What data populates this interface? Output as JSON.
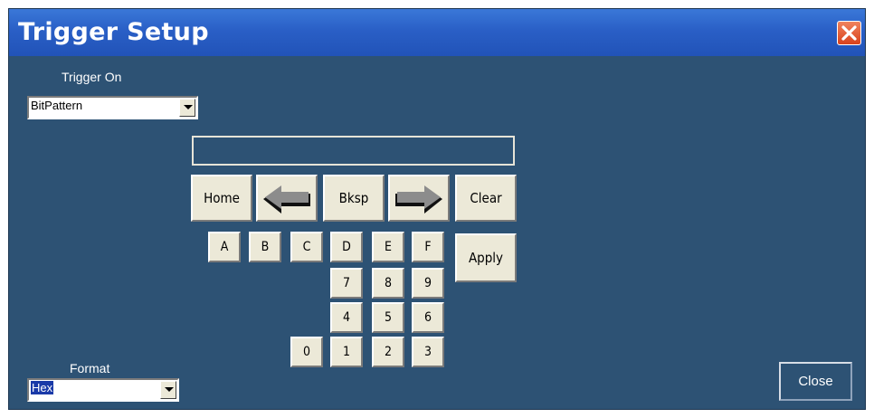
{
  "window": {
    "title": "Trigger Setup",
    "close_icon": "close-x-icon"
  },
  "trigger_on": {
    "label": "Trigger On",
    "selected": "BitPattern"
  },
  "format": {
    "label": "Format",
    "selected": "Hex"
  },
  "pattern_entry": {
    "value": ""
  },
  "keypad": {
    "home": "Home",
    "left_icon": "left-arrow-icon",
    "bksp": "Bksp",
    "right_icon": "right-arrow-icon",
    "clear": "Clear",
    "apply": "Apply",
    "keys": {
      "a": "A",
      "b": "B",
      "c": "C",
      "d": "D",
      "e": "E",
      "f": "F",
      "k7": "7",
      "k8": "8",
      "k9": "9",
      "k4": "4",
      "k5": "5",
      "k6": "6",
      "k0": "0",
      "k1": "1",
      "k2": "2",
      "k3": "3"
    }
  },
  "close_button": {
    "label": "Close"
  },
  "colors": {
    "background": "#2d5274",
    "titlebar": "#2a5fc6",
    "button_face": "#ece9d8",
    "close_x": "#d9421c"
  }
}
